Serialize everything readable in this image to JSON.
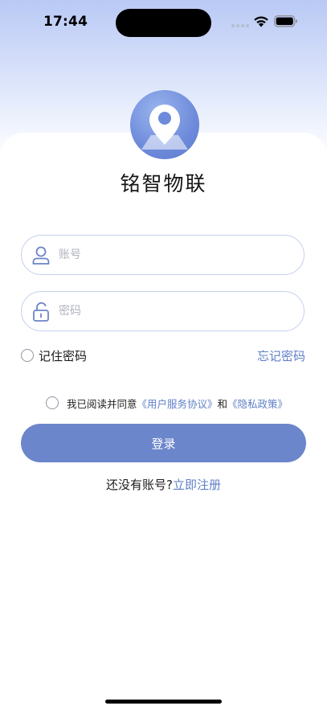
{
  "status_bar": {
    "time": "17:44"
  },
  "app": {
    "title": "铭智物联"
  },
  "form": {
    "account_placeholder": "账号",
    "password_placeholder": "密码",
    "remember_label": "记住密码",
    "forgot_label": "忘记密码",
    "agreement_prefix": "我已阅读并同意",
    "agreement_terms": "《用户服务协议》",
    "agreement_and": "和",
    "agreement_privacy": "《隐私政策》",
    "login_label": "登录",
    "register_prompt": "还没有账号?",
    "register_link": "立即注册"
  },
  "icons": {
    "logo": "location-pin-icon",
    "account": "user-icon",
    "password": "lock-icon",
    "wifi": "wifi-icon",
    "battery": "battery-icon"
  },
  "colors": {
    "accent": "#6c86cb",
    "link": "#5f7fc8",
    "field_border": "#c4d0ea",
    "background_top": "#b9c9f5"
  }
}
